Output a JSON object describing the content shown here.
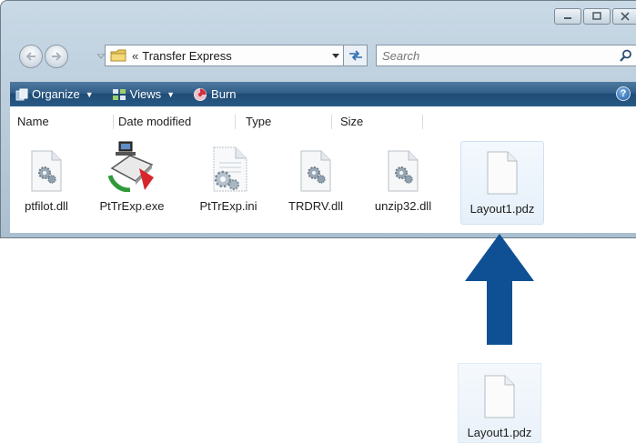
{
  "window": {
    "address": {
      "separator": "«",
      "folder": "Transfer Express"
    },
    "search": {
      "placeholder": "Search"
    },
    "toolbar": {
      "organize": "Organize",
      "views": "Views",
      "burn": "Burn"
    },
    "columns": [
      "Name",
      "Date modified",
      "Type",
      "Size"
    ],
    "files": [
      {
        "name": "ptfilot.dll",
        "icon": "dll-gear-icon"
      },
      {
        "name": "PtTrExp.exe",
        "icon": "transfer-express-app-icon"
      },
      {
        "name": "PtTrExp.ini",
        "icon": "ini-settings-icon"
      },
      {
        "name": "TRDRV.dll",
        "icon": "dll-gear-icon"
      },
      {
        "name": "unzip32.dll",
        "icon": "dll-gear-icon"
      },
      {
        "name": "Layout1.pdz",
        "icon": "blank-document-icon",
        "selected": true
      }
    ]
  },
  "dragged_file": {
    "name": "Layout1.pdz",
    "icon": "blank-document-icon"
  },
  "colors": {
    "arrow": "#0f4f93",
    "command_bar": "#2b5a86"
  }
}
